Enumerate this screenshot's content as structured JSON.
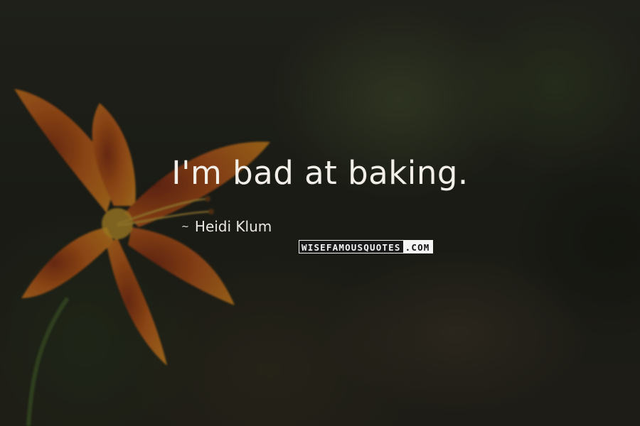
{
  "quote": {
    "text": "I'm bad at baking.",
    "author": "Heidi Klum",
    "author_prefix": "~"
  },
  "watermark": {
    "part1": "WISEFAMOUSQUOTES",
    "part2": ".COM"
  },
  "background": {
    "subject": "orange-lily-flower",
    "colors": {
      "base": "#1f211a",
      "petal": "#d6731f",
      "petal_dark": "#8a2e12",
      "text": "#f1efe8"
    }
  }
}
